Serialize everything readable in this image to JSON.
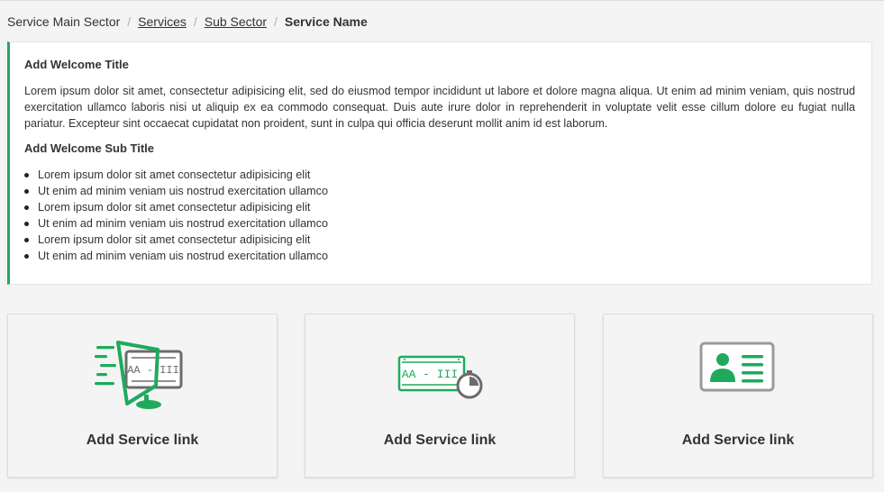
{
  "breadcrumb": {
    "items": [
      "Service Main Sector",
      "Services",
      "Sub Sector"
    ],
    "current": "Service Name"
  },
  "welcome": {
    "title": "Add Welcome Title",
    "paragraph": "Lorem ipsum dolor sit amet, consectetur adipisicing elit, sed do eiusmod tempor incididunt ut labore et dolore magna aliqua. Ut enim ad minim veniam, quis nostrud exercitation ullamco laboris nisi ut aliquip ex ea commodo consequat. Duis aute irure dolor in reprehenderit in voluptate velit esse cillum dolore eu fugiat nulla pariatur. Excepteur sint occaecat cupidatat non proident, sunt in culpa qui officia deserunt mollit anim id est laborum.",
    "subtitle": "Add Welcome Sub Title",
    "bullets": [
      "Lorem ipsum dolor sit amet consectetur adipisicing elit",
      "Ut enim ad minim veniam uis nostrud exercitation ullamco",
      "Lorem ipsum dolor sit amet consectetur adipisicing elit",
      "Ut enim ad minim veniam uis nostrud exercitation ullamco",
      "Lorem ipsum dolor sit amet consectetur adipisicing elit",
      "Ut enim ad minim veniam uis nostrud exercitation ullamco"
    ]
  },
  "services": [
    {
      "label": "Add Service link",
      "icon": "vehicle-plate-scan-icon",
      "plate_text": "AA - III"
    },
    {
      "label": "Add Service link",
      "icon": "vehicle-plate-timer-icon",
      "plate_text": "AA - III"
    },
    {
      "label": "Add Service link",
      "icon": "id-card-icon"
    }
  ],
  "colors": {
    "accent": "#1eaa5c",
    "icon_gray": "#6b6b6b"
  }
}
